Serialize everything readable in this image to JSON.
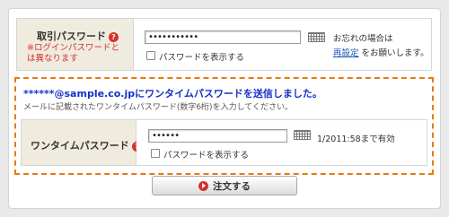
{
  "password_row": {
    "label": "取引パスワード",
    "note": "※ログインパスワードとは異なります",
    "value": "•••••••••••",
    "show_password_label": "パスワードを表示する",
    "forgot_text": "お忘れの場合は",
    "reset_link": "再設定",
    "reset_suffix": "をお願いします。"
  },
  "notice": {
    "title": "******@sample.co.jpにワンタイムパスワードを送信しました。",
    "subtitle": "メールに記載されたワンタイムパスワード(数字6桁)を入力してください。"
  },
  "otp_row": {
    "label": "ワンタイムパスワード",
    "value": "••••••",
    "show_password_label": "パスワードを表示する",
    "expiry": "1/2011:58まで有効"
  },
  "order_button": {
    "label": "注文する"
  },
  "icons": {
    "help": "help-icon",
    "keyboard": "keyboard-icon",
    "play": "play-icon"
  },
  "colors": {
    "note_red": "#d6322a",
    "notice_blue": "#1530c8",
    "link_blue": "#1a55b5",
    "dashed_orange": "#e87914",
    "label_bg": "#f0ebdf"
  }
}
